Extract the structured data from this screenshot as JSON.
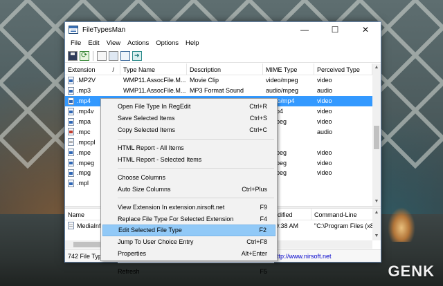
{
  "window": {
    "title": "FileTypesMan",
    "min": "—",
    "max": "☐",
    "close": "✕"
  },
  "menubar": [
    "File",
    "Edit",
    "View",
    "Actions",
    "Options",
    "Help"
  ],
  "toolbar_icons": [
    "save-icon",
    "refresh-icon",
    "copy-icon",
    "properties-icon",
    "find-icon",
    "exit-icon"
  ],
  "list": {
    "columns": [
      "Extension",
      "/",
      "Type Name",
      "Description",
      "MIME Type",
      "Perceived Type"
    ],
    "rows": [
      {
        "ext": ".MP2V",
        "type": "WMP11.AssocFile.M...",
        "desc": "Movie Clip",
        "mime": "video/mpeg",
        "perceived": "video",
        "icon": "blue"
      },
      {
        "ext": ".mp3",
        "type": "WMP11.AssocFile.M...",
        "desc": "MP3 Format Sound",
        "mime": "audio/mpeg",
        "perceived": "audio",
        "icon": "blue"
      },
      {
        "ext": ".mp4",
        "type": "WMP11.AssocFile.M...",
        "desc": "MP4 Video",
        "mime": "video/mp4",
        "perceived": "video",
        "icon": "blue",
        "selected": true
      },
      {
        "ext": ".mp4v",
        "type": "",
        "desc": "",
        "mime": "o/mp4",
        "perceived": "video",
        "icon": "blue"
      },
      {
        "ext": ".mpa",
        "type": "",
        "desc": "",
        "mime": "o/mpeg",
        "perceived": "video",
        "icon": "blue"
      },
      {
        "ext": ".mpc",
        "type": "",
        "desc": "",
        "mime": "",
        "perceived": "audio",
        "icon": "red"
      },
      {
        "ext": ".mpcpl",
        "type": "",
        "desc": "",
        "mime": "",
        "perceived": "",
        "icon": "plain"
      },
      {
        "ext": ".mpe",
        "type": "",
        "desc": "",
        "mime": "o/mpeg",
        "perceived": "video",
        "icon": "blue"
      },
      {
        "ext": ".mpeg",
        "type": "",
        "desc": "",
        "mime": "o/mpeg",
        "perceived": "video",
        "icon": "blue"
      },
      {
        "ext": ".mpg",
        "type": "",
        "desc": "",
        "mime": "o/mpeg",
        "perceived": "video",
        "icon": "blue"
      },
      {
        "ext": ".mpl",
        "type": "",
        "desc": "",
        "mime": "",
        "perceived": "",
        "icon": "blue"
      }
    ]
  },
  "lower": {
    "columns": [
      "Name",
      "",
      "",
      "odified",
      "Command-Line"
    ],
    "rows": [
      {
        "name": "MediaInf",
        "modified": "7 7:19:38 AM",
        "cmd": "\"C:\\Program Files (x86)\\"
      }
    ]
  },
  "status": {
    "count": "742 File Type",
    "link": "ttp://www.nirsoft.net"
  },
  "context_menu": {
    "items": [
      {
        "label": "Open File Type In RegEdit",
        "shortcut": "Ctrl+R"
      },
      {
        "label": "Save Selected Items",
        "shortcut": "Ctrl+S"
      },
      {
        "label": "Copy Selected Items",
        "shortcut": "Ctrl+C"
      },
      {
        "sep": true
      },
      {
        "label": "HTML Report - All Items",
        "shortcut": ""
      },
      {
        "label": "HTML Report - Selected Items",
        "shortcut": ""
      },
      {
        "sep": true
      },
      {
        "label": "Choose Columns",
        "shortcut": ""
      },
      {
        "label": "Auto Size Columns",
        "shortcut": "Ctrl+Plus"
      },
      {
        "sep": true
      },
      {
        "label": "View Extension In extension.nirsoft.net",
        "shortcut": "F9"
      },
      {
        "label": "Replace File Type For Selected Extension",
        "shortcut": "F4"
      },
      {
        "label": "Edit Selected File Type",
        "shortcut": "F2",
        "highlighted": true
      },
      {
        "label": "Jump To User Choice Entry",
        "shortcut": "Ctrl+F8"
      },
      {
        "label": "Properties",
        "shortcut": "Alt+Enter"
      },
      {
        "sep": true
      },
      {
        "label": "Refresh",
        "shortcut": "F5"
      }
    ]
  },
  "brand": "GENK",
  "colors": {
    "selection": "#3399ff",
    "menu_highlight": "#91c9f7",
    "link": "#0000cc"
  }
}
